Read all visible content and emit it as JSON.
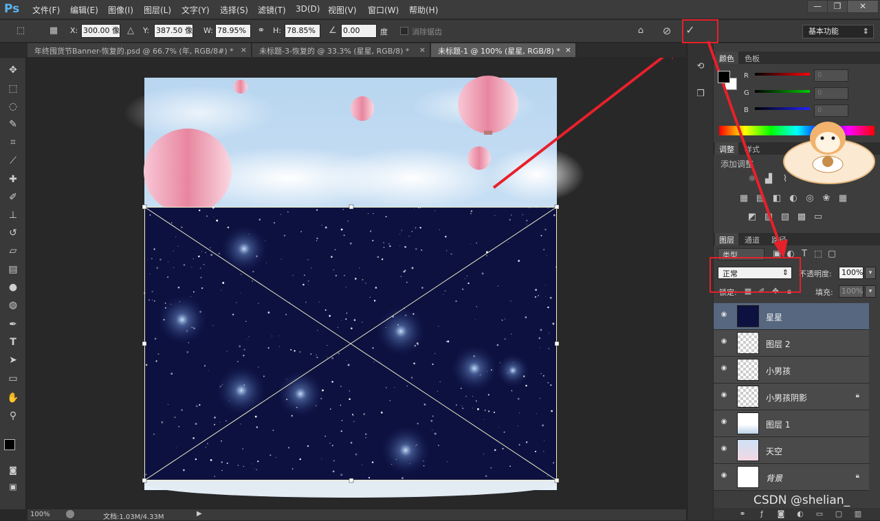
{
  "app": {
    "logo": "Ps"
  },
  "menu": [
    "文件(F)",
    "编辑(E)",
    "图像(I)",
    "图层(L)",
    "文字(Y)",
    "选择(S)",
    "滤镜(T)",
    "3D(D)",
    "视图(V)",
    "窗口(W)",
    "帮助(H)"
  ],
  "options": {
    "x_label": "X:",
    "x_value": "300.00 像",
    "y_label": "Y:",
    "y_value": "387.50 像",
    "w_label": "W:",
    "w_value": "78.95%",
    "h_label": "H:",
    "h_value": "78.85%",
    "angle_value": "0.00",
    "angle_unit": "度",
    "antialias_label": "消除锯齿",
    "workspace": "基本功能"
  },
  "tabs": [
    {
      "label": "年终囤货节Banner-恢复的.psd @ 66.7% (年, RGB/8#) *"
    },
    {
      "label": "未标题-3-恢复的 @ 33.3% (星星, RGB/8) *"
    },
    {
      "label": "未标题-1 @ 100% (星星, RGB/8) *"
    }
  ],
  "status": {
    "zoom": "100%",
    "doc": "文档:1.03M/4.33M"
  },
  "color_panel": {
    "tabs": [
      "颜色",
      "色板"
    ],
    "channels": [
      {
        "label": "R",
        "value": "0"
      },
      {
        "label": "G",
        "value": "0"
      },
      {
        "label": "B",
        "value": "0"
      }
    ]
  },
  "adjust_panel": {
    "tabs": [
      "调整",
      "样式"
    ],
    "title": "添加调整"
  },
  "layers_panel": {
    "tabs": [
      "图层",
      "通道",
      "路径"
    ],
    "filter": "类型",
    "blend_mode": "正常",
    "opacity_label": "不透明度:",
    "opacity_value": "100%",
    "lock_label": "锁定:",
    "fill_label": "填充:",
    "fill_value": "100%",
    "layers": [
      {
        "name": "星星"
      },
      {
        "name": "图层 2"
      },
      {
        "name": "小男孩"
      },
      {
        "name": "小男孩阴影"
      },
      {
        "name": "图层 1"
      },
      {
        "name": "天空"
      },
      {
        "name": "背景"
      }
    ]
  },
  "watermark": "CSDN @shelian_",
  "colors": {
    "accent_red": "#e8202a",
    "selected_layer": "#56677f",
    "night": "#0d1140"
  }
}
